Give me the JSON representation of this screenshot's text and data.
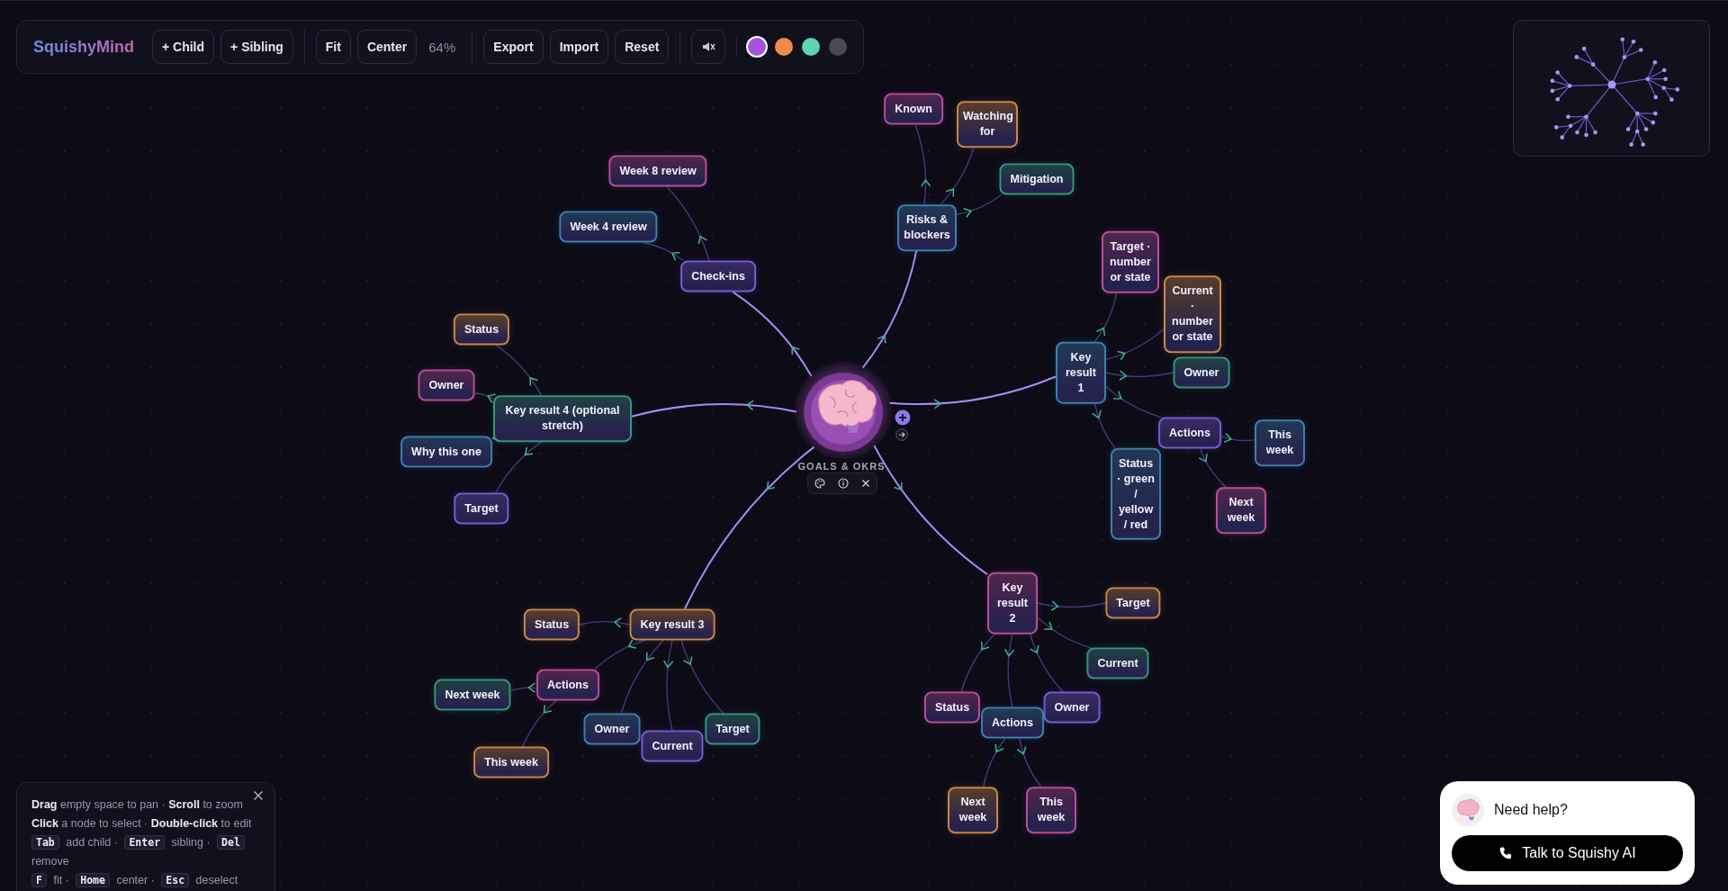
{
  "toolbar": {
    "logo": "SquishyMind",
    "groups": [
      [
        {
          "kind": "button",
          "label": "+ Child"
        },
        {
          "kind": "button",
          "label": "+ Sibling"
        }
      ],
      [
        {
          "kind": "button",
          "label": "Fit"
        },
        {
          "kind": "button",
          "label": "Center"
        },
        {
          "kind": "readout",
          "label": "64%"
        }
      ],
      [
        {
          "kind": "button",
          "label": "Export"
        },
        {
          "kind": "button",
          "label": "Import"
        },
        {
          "kind": "button",
          "label": "Reset"
        }
      ],
      [
        {
          "kind": "sound"
        }
      ]
    ],
    "colors": [
      {
        "color": "#a455e0",
        "selected": true
      },
      {
        "color": "#f08a4b",
        "selected": false
      },
      {
        "color": "#5fd4b0",
        "selected": false
      },
      {
        "color": "#4a4a52",
        "selected": false
      }
    ]
  },
  "map": {
    "root": {
      "label": "GOALS & OKRS",
      "selected": true,
      "children": [
        {
          "label": "Check-ins",
          "color": "#7b5cd6",
          "children": [
            {
              "label": "Week 8 review",
              "color": "#b84f9a"
            },
            {
              "label": "Week 4 review",
              "color": "#3f7fb0"
            }
          ]
        },
        {
          "label": "Risks & blockers",
          "color": "#3f7fb0",
          "children": [
            {
              "label": "Known",
              "color": "#b84f9a"
            },
            {
              "label": "Watching for",
              "color": "#c8874a"
            },
            {
              "label": "Mitigation",
              "color": "#3a9484"
            }
          ]
        },
        {
          "label": "Key result 1",
          "color": "#3f7fb0",
          "children": [
            {
              "label": "Target · number or state",
              "color": "#b84f9a"
            },
            {
              "label": "Current · number or state",
              "color": "#c8874a"
            },
            {
              "label": "Owner",
              "color": "#3a9484"
            },
            {
              "label": "Status · green / yellow / red",
              "color": "#3f7fb0"
            },
            {
              "label": "Actions",
              "color": "#7b5cd6",
              "children": [
                {
                  "label": "This week",
                  "color": "#3f7fb0"
                },
                {
                  "label": "Next week",
                  "color": "#b84f9a"
                }
              ]
            }
          ]
        },
        {
          "label": "Key result 2",
          "color": "#b84f9a",
          "children": [
            {
              "label": "Target",
              "color": "#c8874a"
            },
            {
              "label": "Current",
              "color": "#3a9484"
            },
            {
              "label": "Owner",
              "color": "#7b5cd6"
            },
            {
              "label": "Actions",
              "color": "#3f7fb0",
              "children": [
                {
                  "label": "Next week",
                  "color": "#c8874a"
                },
                {
                  "label": "This week",
                  "color": "#b84f9a"
                }
              ]
            },
            {
              "label": "Status",
              "color": "#b84f9a"
            }
          ]
        },
        {
          "label": "Key result 3",
          "color": "#c8874a",
          "children": [
            {
              "label": "Status",
              "color": "#c8874a"
            },
            {
              "label": "Actions",
              "color": "#b84f9a",
              "children": [
                {
                  "label": "Next week",
                  "color": "#3a9484"
                },
                {
                  "label": "This week",
                  "color": "#c8874a"
                }
              ]
            },
            {
              "label": "Owner",
              "color": "#3f7fb0"
            },
            {
              "label": "Current",
              "color": "#7b5cd6"
            },
            {
              "label": "Target",
              "color": "#3a9484"
            }
          ]
        },
        {
          "label": "Key result 4 (optional stretch)",
          "color": "#3a9484",
          "children": [
            {
              "label": "Status",
              "color": "#c8874a"
            },
            {
              "label": "Owner",
              "color": "#b84f9a"
            },
            {
              "label": "Why this one",
              "color": "#3f7fb0"
            },
            {
              "label": "Target",
              "color": "#7b5cd6"
            }
          ]
        }
      ]
    }
  },
  "help": {
    "lines": [
      [
        {
          "kind": "text",
          "text": "**Drag** empty space to pan · **Scroll** to zoom"
        }
      ],
      [
        {
          "kind": "text",
          "text": "**Click** a node to select · **Double-click** to edit"
        }
      ],
      [
        {
          "kind": "key",
          "text": "Tab"
        },
        {
          "kind": "text",
          "text": "add child ·"
        },
        {
          "kind": "key",
          "text": "Enter"
        },
        {
          "kind": "text",
          "text": "sibling ·"
        },
        {
          "kind": "key",
          "text": "Del"
        },
        {
          "kind": "text",
          "text": "remove"
        }
      ],
      [
        {
          "kind": "key",
          "text": "F"
        },
        {
          "kind": "text",
          "text": "fit ·"
        },
        {
          "kind": "key",
          "text": "Home"
        },
        {
          "kind": "text",
          "text": "center ·"
        },
        {
          "kind": "key",
          "text": "Esc"
        },
        {
          "kind": "text",
          "text": "deselect"
        }
      ]
    ]
  },
  "support": {
    "title": "Need help?",
    "button": "Talk to Squishy AI"
  }
}
